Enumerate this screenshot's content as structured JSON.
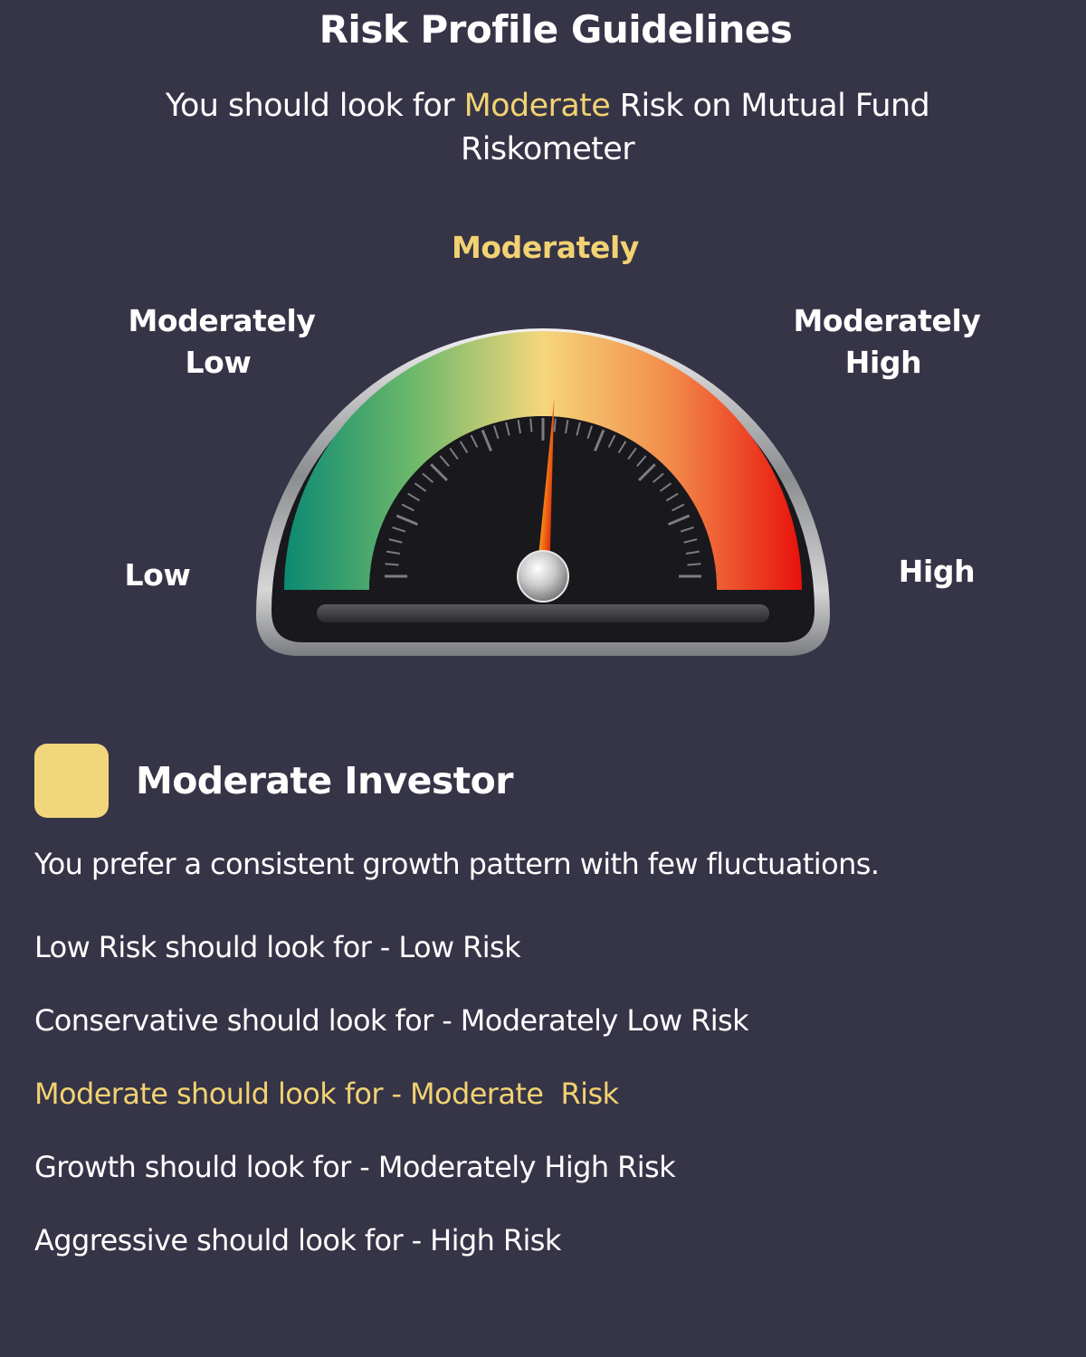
{
  "header": {
    "title": "Risk Profile Guidelines",
    "subtitle_prefix": "You should look for",
    "subtitle_highlight": "Moderate",
    "subtitle_suffix": "Risk on Mutual Fund Riskometer"
  },
  "gauge": {
    "labels": {
      "low": "Low",
      "moderately_low_1": "Moderately",
      "moderately_low_2": "Low",
      "moderate": "Moderately",
      "moderately_high_1": "Moderately",
      "moderately_high_2": "High",
      "high": "High"
    },
    "needle_level": 0.52,
    "colors": {
      "low": "#0b8a72",
      "moderately_low": "#6db96a",
      "moderate": "#f5d67c",
      "moderately_high": "#f28a4a",
      "high": "#e8110c"
    }
  },
  "investor": {
    "title": "Moderate Investor",
    "swatch_color": "#f2d67c",
    "description": "You prefer a consistent growth pattern with few fluctuations."
  },
  "guidelines": [
    {
      "text": "Low Risk should look for - Low Risk",
      "active": false
    },
    {
      "text": "Conservative should look for - Moderately Low Risk",
      "active": false
    },
    {
      "text": "Moderate should look for - Moderate  Risk",
      "active": true
    },
    {
      "text": "Growth should look for - Moderately High Risk",
      "active": false
    },
    {
      "text": "Aggressive should look for - High Risk",
      "active": false
    }
  ],
  "theme": {
    "background": "#363447",
    "accent": "#f2d272"
  }
}
